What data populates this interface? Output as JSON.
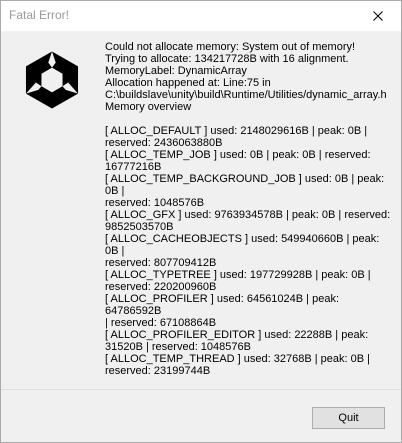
{
  "window": {
    "title": "Fatal Error!",
    "close_icon": "close-icon",
    "logo_icon": "unity-logo"
  },
  "dialog": {
    "message": "Could not allocate memory: System out of memory!\nTrying to allocate: 134217728B with 16 alignment.\nMemoryLabel: DynamicArray\nAllocation happened at: Line:75 in\nC:\\buildslave\\unity\\build\\Runtime/Utilities/dynamic_array.h\nMemory overview\n\n[ ALLOC_DEFAULT ] used: 2148029616B | peak: 0B |\nreserved: 2436063880B\n[ ALLOC_TEMP_JOB ] used: 0B | peak: 0B | reserved:\n16777216B\n[ ALLOC_TEMP_BACKGROUND_JOB ] used: 0B | peak: 0B |\nreserved: 1048576B\n[ ALLOC_GFX ] used: 9763934578B | peak: 0B | reserved:\n9852503570B\n[ ALLOC_CACHEOBJECTS ] used: 549940660B | peak: 0B |\nreserved: 807709412B\n[ ALLOC_TYPETREE ] used: 197729928B | peak: 0B |\nreserved: 220200960B\n[ ALLOC_PROFILER ] used: 64561024B | peak: 64786592B\n| reserved: 67108864B\n[ ALLOC_PROFILER_EDITOR ] used: 22288B | peak:\n31520B | reserved: 1048576B\n[ ALLOC_TEMP_THREAD ] used: 32768B | peak: 0B |\nreserved: 23199744B",
    "quit_label": "Quit"
  }
}
